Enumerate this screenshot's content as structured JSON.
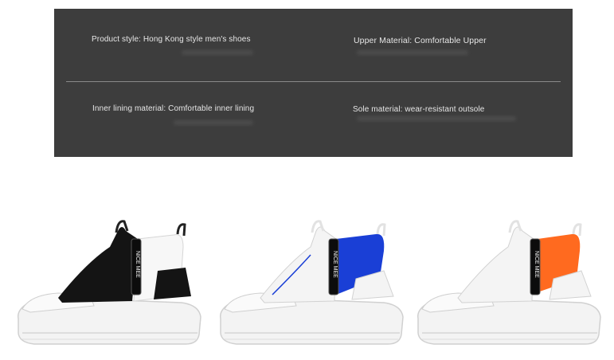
{
  "specs": {
    "product_style": "Product style: Hong Kong style men's shoes",
    "upper_material": "Upper Material: Comfortable Upper",
    "inner_lining": "Inner lining material: Comfortable inner lining",
    "sole_material": "Sole material: wear-resistant outsole"
  },
  "tag_text": "NICE MEE",
  "colors": {
    "panel": "#3d3d3d",
    "shoe_black": "#111111",
    "shoe_blue": "#1a3fd6",
    "shoe_orange": "#ff6a1f",
    "sole": "#f2f2f2"
  }
}
